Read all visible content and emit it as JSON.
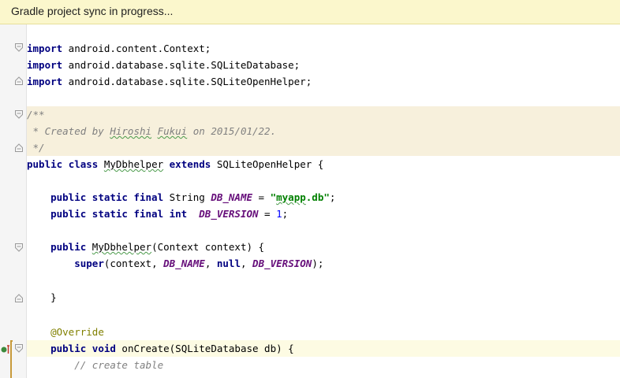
{
  "banner": {
    "text": "Gradle project sync in progress..."
  },
  "colors": {
    "keyword": "#000080",
    "comment": "#808080",
    "constant": "#660e7a",
    "string": "#008000",
    "number": "#0000ff",
    "annotation": "#808000",
    "banner_bg": "#fbf7cc",
    "doc_bg": "#f7f0dc"
  },
  "icons": {
    "fold_open": "fold-open-icon",
    "fold_close": "fold-close-icon",
    "run_marker": "override-marker-icon"
  },
  "code": {
    "l1": {
      "kw": "import",
      "rest": " android.content.Context;"
    },
    "l2": {
      "kw": "import",
      "rest": " android.database.sqlite.SQLiteDatabase;"
    },
    "l3": {
      "kw": "import",
      "rest": " android.database.sqlite.SQLiteOpenHelper;"
    },
    "l5": {
      "text": "/**"
    },
    "l6": {
      "pre": " * Created by ",
      "name1": "Hiroshi",
      "sp": " ",
      "name2": "Fukui",
      "post": " on 2015/01/22."
    },
    "l7": {
      "text": " */"
    },
    "l8": {
      "kw1": "public",
      "sp1": " ",
      "kw2": "class",
      "sp2": " ",
      "cls": "MyDbhelper",
      "sp3": " ",
      "kw3": "extends",
      "rest": " SQLiteOpenHelper {"
    },
    "l10": {
      "indent": "    ",
      "kw": "public static final",
      "type": " String ",
      "const": "DB_NAME",
      "eq": " = ",
      "q1": "\"",
      "str": "myapp",
      "str2": ".db",
      "q2": "\"",
      "end": ";"
    },
    "l11": {
      "indent": "    ",
      "kw": "public static final int",
      "sp": "  ",
      "const": "DB_VERSION",
      "eq": " = ",
      "num": "1",
      "end": ";"
    },
    "l13": {
      "indent": "    ",
      "kw": "public",
      "sp": " ",
      "cls": "MyDbhelper",
      "rest": "(Context context) {"
    },
    "l14": {
      "indent": "        ",
      "kw": "super",
      "p1": "(context, ",
      "c1": "DB_NAME",
      "p2": ", ",
      "kw2": "null",
      "p3": ", ",
      "c2": "DB_VERSION",
      "p4": ");"
    },
    "l16": {
      "indent": "    ",
      "text": "}"
    },
    "l18": {
      "indent": "    ",
      "ann": "@Override"
    },
    "l19": {
      "indent": "    ",
      "kw": "public void",
      "rest": " onCreate(SQLiteDatabase db) {"
    },
    "l20": {
      "indent": "        ",
      "cm": "// create table"
    }
  }
}
